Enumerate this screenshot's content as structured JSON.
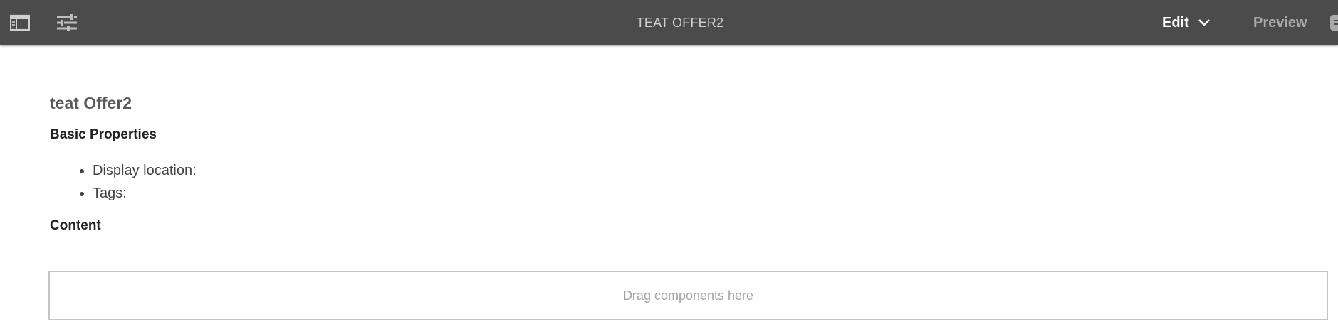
{
  "toolbar": {
    "title": "TEAT OFFER2",
    "edit_label": "Edit",
    "preview_label": "Preview",
    "icons": {
      "side_panel": "side-panel-toggle-icon",
      "page_properties": "sliders-icon",
      "edit_dropdown": "chevron-down-icon",
      "page_info": "page-info-icon"
    },
    "colors": {
      "bar": "#4b4b4b",
      "title": "#d0d0d0",
      "active_mode": "#ffffff",
      "inactive_mode": "#a9a9a9"
    }
  },
  "page": {
    "heading": "teat Offer2",
    "basic_properties_title": "Basic Properties",
    "properties": [
      "Display location:",
      "Tags:"
    ],
    "content_title": "Content"
  },
  "dropzone": {
    "placeholder": "Drag components here"
  }
}
